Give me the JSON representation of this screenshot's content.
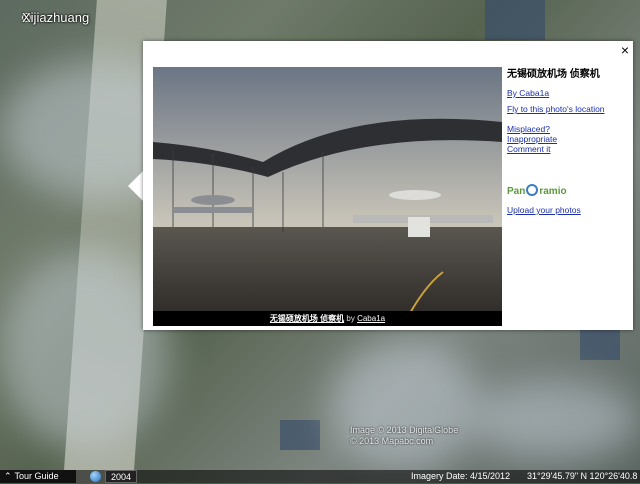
{
  "map": {
    "place_label": "Xijiazhuang",
    "watermark_line1": "Image © 2013 DigitalGlobe",
    "watermark_line2": "© 2013 Mapabc.com"
  },
  "statusbar": {
    "tour_guide": "Tour Guide",
    "year": "2004",
    "imagery_date": "Imagery Date: 4/15/2012",
    "coordinates": "31°29'45.79\" N  120°26'40.8"
  },
  "balloon": {
    "close_label": "×",
    "photo_title": "无锡硕放机场 侦察机",
    "author_link": "By Caba1a",
    "fly_link": "Fly to this photo's location",
    "misplaced_link": "Misplaced?",
    "inappropriate_link": "Inappropriate",
    "comment_link": "Comment it",
    "logo_text_a": "Pan",
    "logo_text_b": "ramio",
    "upload_link": "Upload your photos",
    "caption_title": "无锡硕放机场 侦察机",
    "caption_by": "by",
    "caption_author": "Caba1a"
  }
}
